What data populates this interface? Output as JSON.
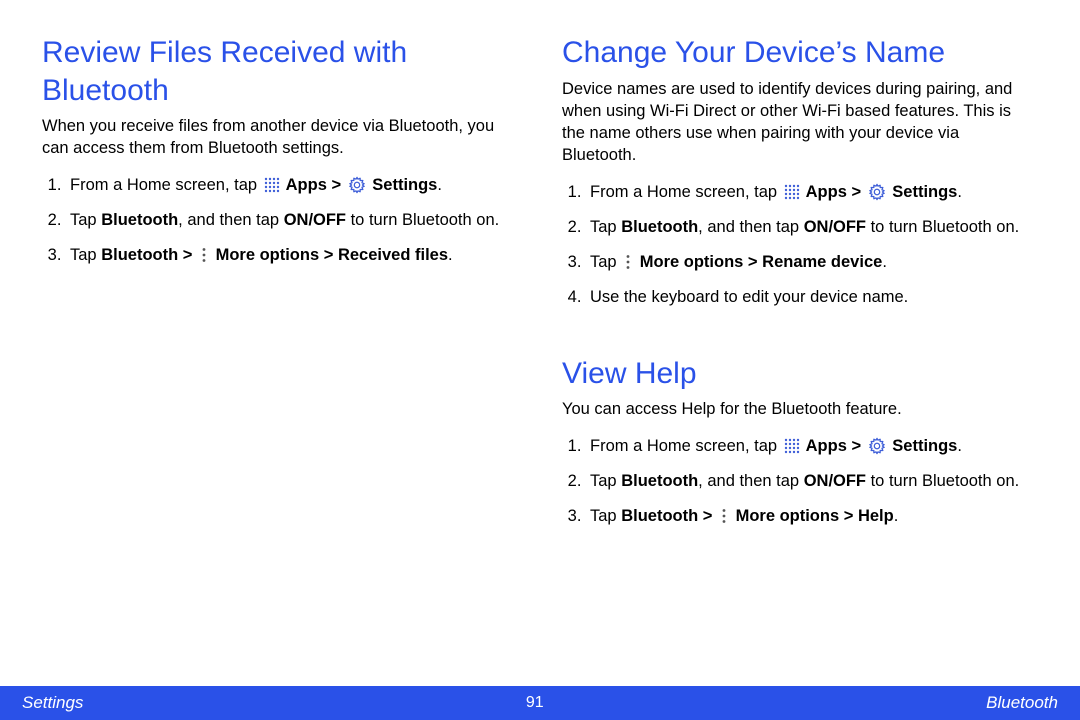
{
  "left": {
    "heading": "Review Files Received with Bluetooth",
    "intro": "When you receive files from another device via Bluetooth, you can access them from Bluetooth settings.",
    "step1_a": "From a Home screen, tap ",
    "step1_b": " Apps > ",
    "step1_c": " Settings",
    "step1_d": ".",
    "step2_a": "Tap ",
    "step2_b": "Bluetooth",
    "step2_c": ", and then tap ",
    "step2_d": "ON/OFF",
    "step2_e": " to turn Bluetooth on.",
    "step3_a": "Tap ",
    "step3_b": "Bluetooth > ",
    "step3_c": " More options > Received files",
    "step3_d": "."
  },
  "right1": {
    "heading": "Change Your Device’s Name",
    "intro": "Device names are used to identify devices during pairing, and when using Wi-Fi Direct or other Wi-Fi based features. This is the name others use when pairing with your device via Bluetooth.",
    "step1_a": "From a Home screen, tap ",
    "step1_b": " Apps > ",
    "step1_c": " Settings",
    "step1_d": ".",
    "step2_a": "Tap ",
    "step2_b": "Bluetooth",
    "step2_c": ", and then tap ",
    "step2_d": "ON/OFF",
    "step2_e": " to turn Bluetooth on.",
    "step3_a": "Tap ",
    "step3_b": " More options > Rename device",
    "step3_c": ".",
    "step4": "Use the keyboard to edit your device name."
  },
  "right2": {
    "heading": "View Help",
    "intro": "You can access Help for the Bluetooth feature.",
    "step1_a": "From a Home screen, tap ",
    "step1_b": " Apps > ",
    "step1_c": " Settings",
    "step1_d": ".",
    "step2_a": "Tap ",
    "step2_b": "Bluetooth",
    "step2_c": ", and then tap ",
    "step2_d": "ON/OFF",
    "step2_e": " to turn Bluetooth on.",
    "step3_a": "Tap ",
    "step3_b": "Bluetooth > ",
    "step3_c": " More options > Help",
    "step3_d": "."
  },
  "footer": {
    "left": "Settings",
    "center": "91",
    "right": "Bluetooth"
  }
}
